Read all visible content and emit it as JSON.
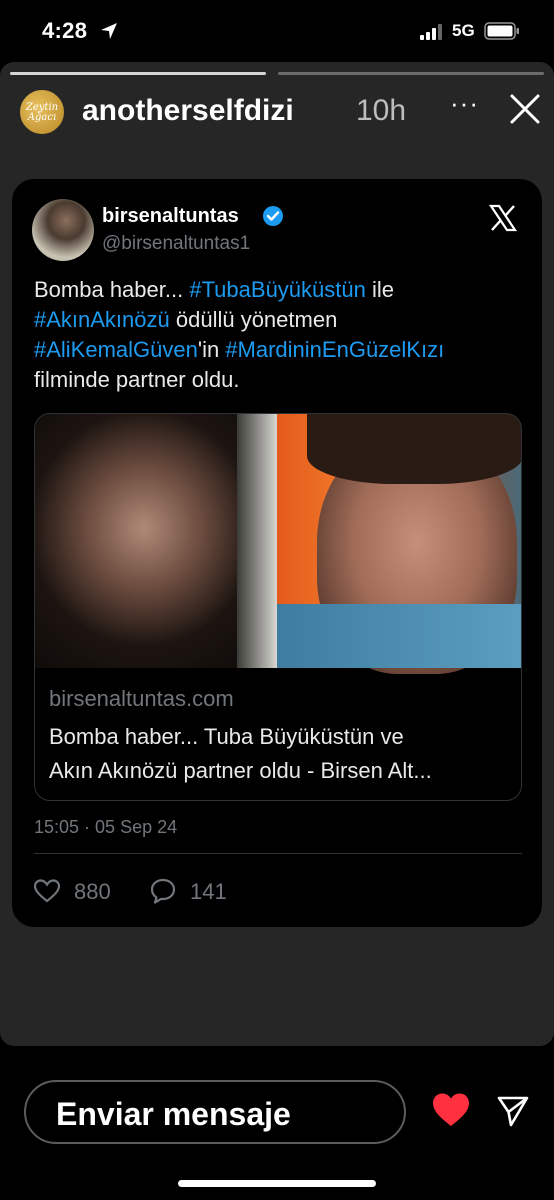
{
  "status_bar": {
    "time": "4:28",
    "network": "5G"
  },
  "story": {
    "account_avatar_text": "Zeytin Ağacı",
    "username": "anotherselfdizi",
    "time_ago": "10h",
    "more_label": "···"
  },
  "tweet": {
    "display_name": "birsenaltuntas",
    "handle": "@birsenaltuntas1",
    "text_parts": {
      "p1": "Bomba haber... ",
      "h1": "#TubaBüyüküstün",
      "p2": " ile",
      "h2": "#AkınAkınözü",
      "p3": " ödüllü yönetmen",
      "h3": "#AliKemalGüven",
      "p4": "'in ",
      "h4": "#MardininEnGüzelKızı",
      "p5": "filminde partner oldu."
    },
    "link": {
      "domain": "birsenaltuntas.com",
      "title_line1": "Bomba haber... Tuba Büyüküstün ve",
      "title_line2": "Akın Akınözü partner oldu - Birsen Alt..."
    },
    "date": "15:05 · 05 Sep 24",
    "likes": "880",
    "replies": "141"
  },
  "reply_bar": {
    "placeholder": "Enviar mensaje"
  },
  "colors": {
    "hashtag": "#1d9bf0",
    "heart": "#ff3040",
    "verified": "#1d9bf0",
    "story_bg": "#262626"
  }
}
